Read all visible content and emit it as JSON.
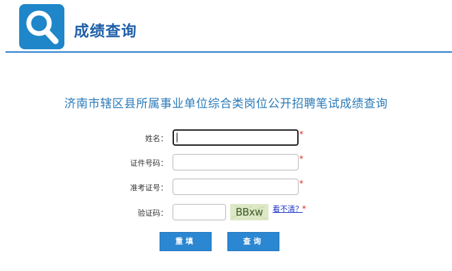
{
  "header": {
    "title": "成绩查询",
    "logo_icon": "search-icon",
    "accent_color": "#1e86c9"
  },
  "page_title": "济南市辖区县所属事业单位综合类岗位公开招聘笔试成绩查询",
  "form": {
    "name_label": "姓名：",
    "id_label": "证件号码：",
    "exam_label": "准考证号：",
    "captcha_label": "验证码：",
    "name_value": "",
    "id_value": "",
    "exam_value": "",
    "captcha_value": "",
    "required_mark": "*",
    "captcha_text": "BBxw",
    "refresh_label": "看不清？"
  },
  "buttons": {
    "reset_label": "重填",
    "query_label": "查询"
  }
}
